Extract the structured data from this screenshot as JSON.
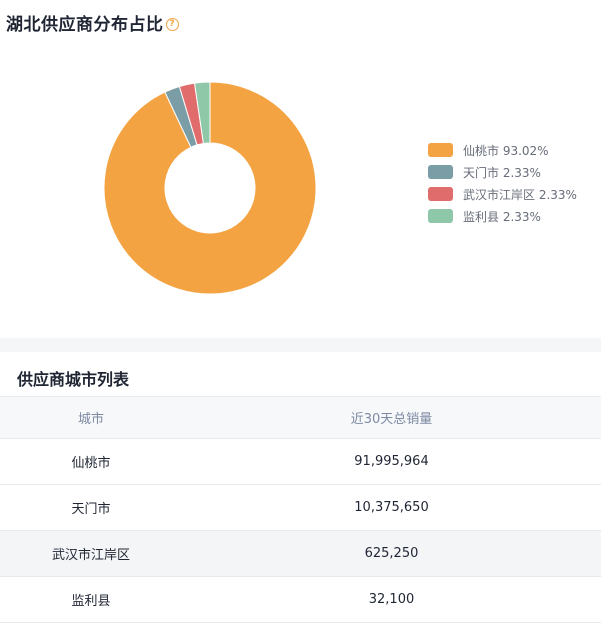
{
  "chart_panel": {
    "title": "湖北供应商分布占比",
    "help_glyph": "?"
  },
  "chart_data": {
    "type": "pie",
    "title": "湖北供应商分布占比",
    "labels": [
      "仙桃市",
      "天门市",
      "武汉市江岸区",
      "监利县"
    ],
    "values": [
      93.02,
      2.33,
      2.33,
      2.33
    ],
    "colors": [
      "#f4a342",
      "#7b9ea6",
      "#e06c6c",
      "#8fc8a8"
    ],
    "legend": [
      "仙桃市 93.02%",
      "天门市 2.33%",
      "武汉市江岸区 2.33%",
      "监利县 2.33%"
    ],
    "legend_position": "right"
  },
  "list_panel": {
    "title": "供应商城市列表",
    "headers": [
      "城市",
      "近30天总销量"
    ],
    "rows": [
      {
        "city": "仙桃市",
        "sales": "91,995,964"
      },
      {
        "city": "天门市",
        "sales": "10,375,650"
      },
      {
        "city": "武汉市江岸区",
        "sales": "625,250"
      },
      {
        "city": "监利县",
        "sales": "32,100"
      }
    ]
  }
}
